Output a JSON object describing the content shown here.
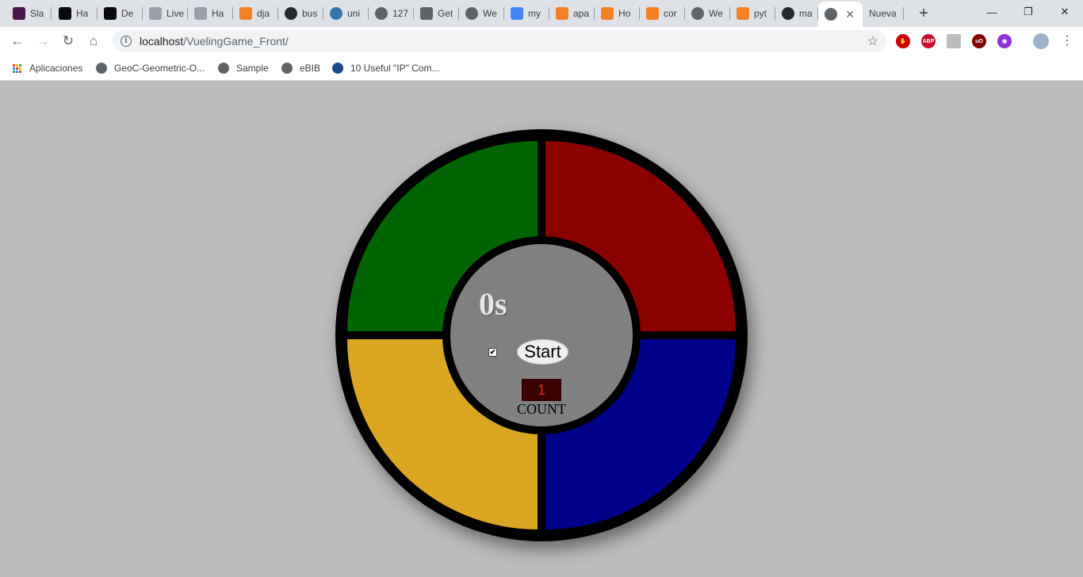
{
  "browser": {
    "tabs": [
      {
        "label": "Sla",
        "icon": "slack-icon",
        "color": "#4a154b"
      },
      {
        "label": "Ha",
        "icon": "devto-icon",
        "color": "#0a0a0a"
      },
      {
        "label": "De",
        "icon": "devto-icon",
        "color": "#0a0a0a"
      },
      {
        "label": "Live",
        "icon": "liveshare-icon",
        "color": "#9aa0a6"
      },
      {
        "label": "Ha",
        "icon": "liveshare-icon",
        "color": "#9aa0a6"
      },
      {
        "label": "dja",
        "icon": "stackoverflow-icon",
        "color": "#f48024"
      },
      {
        "label": "bus",
        "icon": "github-icon",
        "color": "#24292e"
      },
      {
        "label": "uni",
        "icon": "python-icon",
        "color": "#3776ab"
      },
      {
        "label": "127",
        "icon": "globe-icon",
        "color": "#5f6368"
      },
      {
        "label": "Get",
        "icon": "document-icon",
        "color": "#5f6368"
      },
      {
        "label": "We",
        "icon": "globe-icon",
        "color": "#5f6368"
      },
      {
        "label": "my",
        "icon": "google-icon",
        "color": "#4285f4"
      },
      {
        "label": "apa",
        "icon": "stackoverflow-icon",
        "color": "#f48024"
      },
      {
        "label": "Ho",
        "icon": "stackoverflow-icon",
        "color": "#f48024"
      },
      {
        "label": "cor",
        "icon": "stackoverflow-icon",
        "color": "#f48024"
      },
      {
        "label": "We",
        "icon": "globe-icon",
        "color": "#5f6368"
      },
      {
        "label": "pyt",
        "icon": "stackoverflow-icon",
        "color": "#f48024"
      },
      {
        "label": "ma",
        "icon": "github-icon",
        "color": "#24292e"
      },
      {
        "label": "",
        "icon": "globe-icon",
        "color": "#5f6368",
        "active": true
      },
      {
        "label": "Nueva",
        "icon": "",
        "color": ""
      }
    ],
    "url_host": "localhost",
    "url_path": "/VuelingGame_Front/",
    "bookmarks": [
      {
        "label": "Aplicaciones",
        "icon": "apps-grid-icon"
      },
      {
        "label": "GeoC-Geometric-O...",
        "icon": "globe-icon"
      },
      {
        "label": "Sample",
        "icon": "globe-icon"
      },
      {
        "label": "eBIB",
        "icon": "globe-icon"
      },
      {
        "label": "10 Useful \"IP\" Com...",
        "icon": "bookmark-site-icon"
      }
    ],
    "extensions": [
      {
        "name": "block-ext-icon",
        "color": "#cc0000",
        "text": "✋"
      },
      {
        "name": "adblock-plus-icon",
        "color": "#c70d2c",
        "text": "ABP"
      },
      {
        "name": "page-ext-icon",
        "color": "#bdbdbd",
        "text": ""
      },
      {
        "name": "ublock-icon",
        "color": "#800000",
        "text": "uO"
      },
      {
        "name": "purple-ext-icon",
        "color": "#8e2fd8",
        "text": "◉"
      }
    ]
  },
  "game": {
    "timer": "0s",
    "strict_checked": true,
    "start_label": "Start",
    "count_value": "1",
    "count_label": "COUNT",
    "colors": {
      "green": "#006400",
      "red": "#8b0000",
      "yellow": "#daa520",
      "blue": "#00008b"
    }
  }
}
